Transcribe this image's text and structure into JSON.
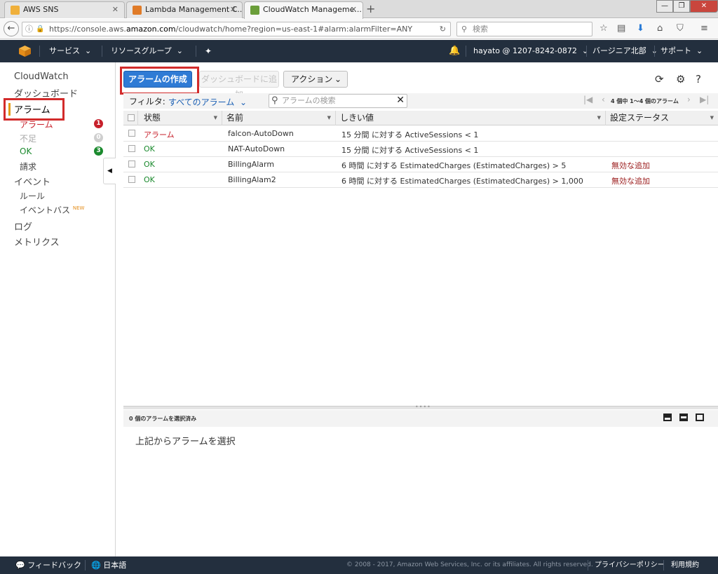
{
  "browser": {
    "tabs": [
      {
        "title": "AWS SNS",
        "active": false
      },
      {
        "title": "Lambda Management C...",
        "active": false
      },
      {
        "title": "CloudWatch Manageme...",
        "active": true
      }
    ],
    "new_tab": "+",
    "url_prefix": "https://console.aws.",
    "url_domain": "amazon.com",
    "url_suffix": "/cloudwatch/home?region=us-east-1#alarm:alarmFilter=ANY",
    "search_placeholder": "検索"
  },
  "aws_header": {
    "services": "サービス",
    "resource_groups": "リソースグループ",
    "account": "hayato @ 1207-8242-0872",
    "region": "バージニア北部",
    "support": "サポート"
  },
  "sidebar": {
    "title": "CloudWatch",
    "dashboard": "ダッシュボード",
    "alarms": "アラーム",
    "alarm_sub": [
      {
        "label": "アラーム",
        "count": "1",
        "color": "#c7202b"
      },
      {
        "label": "不足",
        "count": "0",
        "color": "#cfcfcf"
      },
      {
        "label": "OK",
        "count": "3",
        "color": "#1b8a2e"
      }
    ],
    "billing": "請求",
    "events": "イベント",
    "rules": "ルール",
    "event_bus": "イベントバス",
    "new_badge": "NEW",
    "logs": "ログ",
    "metrics": "メトリクス"
  },
  "toolbar": {
    "create_alarm": "アラームの作成",
    "add_to_dashboard": "ダッシュボードに追加",
    "actions": "アクション"
  },
  "filter": {
    "label": "フィルタ:",
    "value": "すべてのアラーム",
    "search_placeholder": "アラームの検索",
    "pager_text": "4 個中 1〜4 個のアラーム"
  },
  "table": {
    "columns": [
      "状態",
      "名前",
      "しきい値",
      "設定ステータス"
    ],
    "rows": [
      {
        "state": "アラーム",
        "name": "falcon-AutoDown",
        "threshold": "15 分間 に対する ActiveSessions < 1",
        "config": ""
      },
      {
        "state": "OK",
        "name": "NAT-AutoDown",
        "threshold": "15 分間 に対する ActiveSessions < 1",
        "config": ""
      },
      {
        "state": "OK",
        "name": "BillingAlarm",
        "threshold": "6 時間 に対する EstimatedCharges (EstimatedCharges) > 5",
        "config": "無効な追加"
      },
      {
        "state": "OK",
        "name": "BillingAlam2",
        "threshold": "6 時間 に対する EstimatedCharges (EstimatedCharges) > 1,000",
        "config": "無効な追加"
      }
    ]
  },
  "detail": {
    "selected_count": "0 個のアラームを選択済み",
    "message": "上記からアラームを選択"
  },
  "footer": {
    "feedback": "フィードバック",
    "language": "日本語",
    "copyright": "© 2008 - 2017, Amazon Web Services, Inc. or its affiliates. All rights reserved.",
    "privacy": "プライバシーポリシー",
    "terms": "利用規約"
  },
  "colors": {
    "alarm_red": "#c7202b",
    "ok_green": "#1b8a2e",
    "primary_blue": "#2f7bd5",
    "aws_dark": "#232f3e"
  }
}
